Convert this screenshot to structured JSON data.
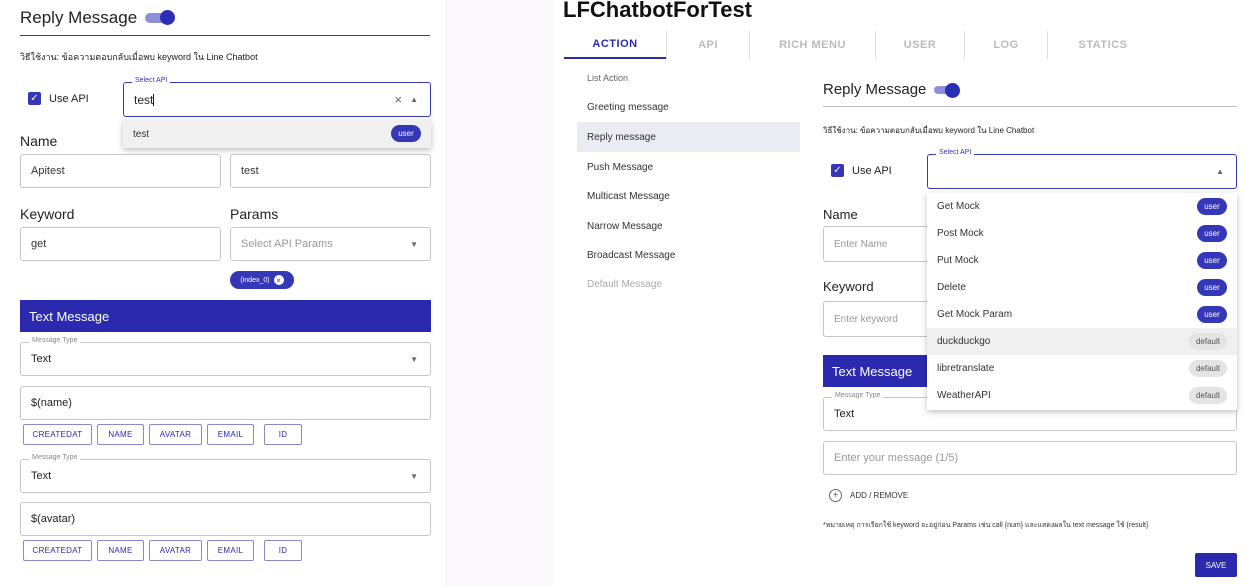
{
  "left": {
    "title": "Reply Message",
    "usage": "วิธีใช้งาน: ข้อความตอบกลับเมื่อพบ keyword ใน Line Chatbot",
    "use_api_label": "Use API",
    "select_api_legend": "Select API",
    "select_api_value": "test",
    "clear_glyph": "×",
    "dropdown_option": {
      "label": "test",
      "badge": "user"
    },
    "name_label": "Name",
    "name_value": "Apitest",
    "second_value": "test",
    "keyword_label": "Keyword",
    "keyword_value": "get",
    "params_label": "Params",
    "params_placeholder": "Select API Params",
    "param_chip": "(index_0)",
    "text_message_header": "Text Message",
    "message_type_legend": "Message Type",
    "message_type_value": "Text",
    "message1": "$(name)",
    "message2": "$(avatar)",
    "var_buttons": [
      "CREATEDAT",
      "NAME",
      "AVATAR",
      "EMAIL",
      "ID"
    ]
  },
  "right": {
    "app_title": "LFChatbotForTest",
    "tabs": [
      "ACTION",
      "API",
      "RICH MENU",
      "USER",
      "LOG",
      "STATICS"
    ],
    "sidebar_header": "List Action",
    "sidebar_items": [
      "Greeting message",
      "Reply message",
      "Push Message",
      "Multicast Message",
      "Narrow Message",
      "Broadcast Message",
      "Default Message"
    ],
    "title": "Reply Message",
    "usage": "วิธีใช้งาน: ข้อความตอบกลับเมื่อพบ keyword ใน Line Chatbot",
    "use_api_label": "Use API",
    "select_api_legend": "Select API",
    "api_options": [
      {
        "label": "Get Mock",
        "badge": "user"
      },
      {
        "label": "Post Mock",
        "badge": "user"
      },
      {
        "label": "Put Mock",
        "badge": "user"
      },
      {
        "label": "Delete",
        "badge": "user"
      },
      {
        "label": "Get Mock Param",
        "badge": "user"
      },
      {
        "label": "duckduckgo",
        "badge": "default"
      },
      {
        "label": "libretranslate",
        "badge": "default"
      },
      {
        "label": "WeatherAPI",
        "badge": "default"
      }
    ],
    "name_label": "Name",
    "name_placeholder": "Enter Name",
    "keyword_label": "Keyword",
    "keyword_placeholder": "Enter keyword",
    "text_message_header": "Text Message",
    "message_type_legend": "Message Type",
    "message_type_value": "Text",
    "message_placeholder": "Enter your message (1/5)",
    "add_remove_label": "ADD / REMOVE",
    "note": "*หมายเหตุ การเรียกใช้ keyword จะอยู่ก่อน Params เช่น call {num} และแสดงผลใน text message ใช้ {result}",
    "save_label": "SAVE"
  },
  "colors": {
    "accent": "#2b2aae",
    "badge_default": "#e4e4e4"
  }
}
